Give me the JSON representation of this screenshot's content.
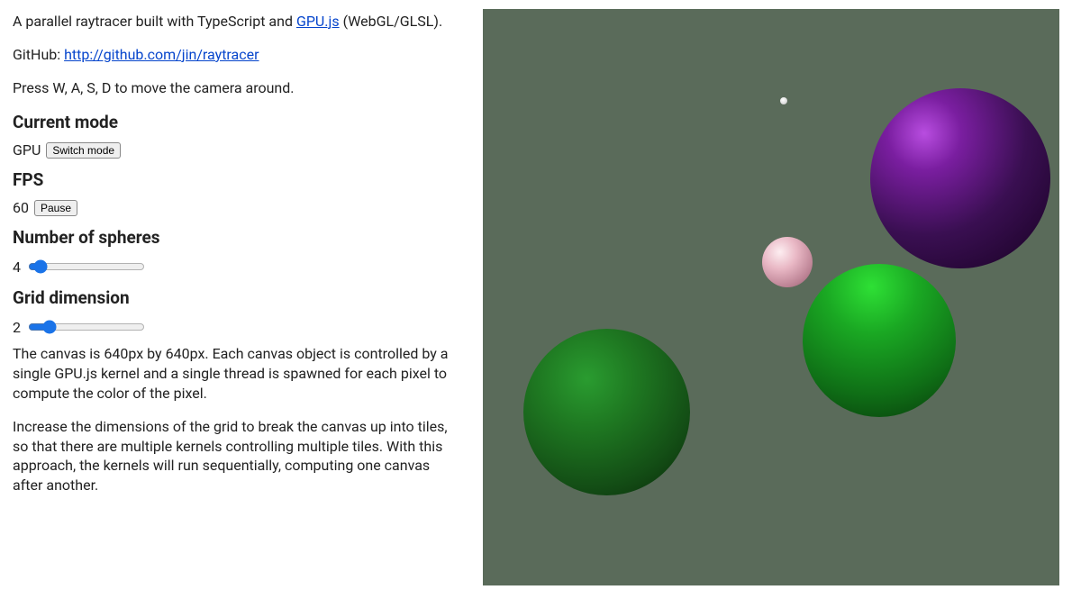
{
  "intro": {
    "line1_pre": "A parallel raytracer built with TypeScript and ",
    "gpujs_link_text": "GPU.js",
    "line1_post": " (WebGL/GLSL).",
    "github_label": "GitHub: ",
    "github_url": "http://github.com/jin/raytracer",
    "instructions": "Press W, A, S, D to move the camera around."
  },
  "mode": {
    "heading": "Current mode",
    "value": "GPU",
    "button": "Switch mode"
  },
  "fps": {
    "heading": "FPS",
    "value": "60",
    "button": "Pause"
  },
  "spheres": {
    "heading": "Number of spheres",
    "value": "4",
    "min": "1",
    "max": "60"
  },
  "grid": {
    "heading": "Grid dimension",
    "value": "2",
    "min": "1",
    "max": "8"
  },
  "desc": {
    "p1": "The canvas is 640px by 640px. Each canvas object is controlled by a single GPU.js kernel and a single thread is spawned for each pixel to compute the color of the pixel.",
    "p2": "Increase the dimensions of the grid to break the canvas up into tiles, so that there are multiple kernels controlling multiple tiles. With this approach, the kernels will run sequentially, computing one canvas after another."
  }
}
